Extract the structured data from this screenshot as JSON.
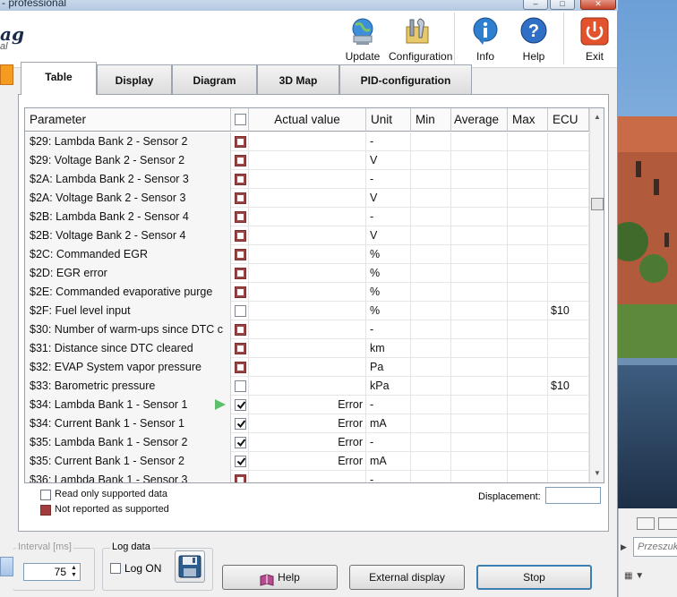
{
  "window": {
    "title": "- professional",
    "brand": "ag",
    "brand_sub": "al"
  },
  "toolbar": [
    {
      "label": "Update",
      "icon": "update-globe-icon"
    },
    {
      "label": "Configuration",
      "icon": "configuration-tools-icon"
    },
    {
      "label": "Info",
      "icon": "info-icon"
    },
    {
      "label": "Help",
      "icon": "help-question-icon"
    },
    {
      "label": "Exit",
      "icon": "power-exit-icon"
    }
  ],
  "tabs": [
    "Table",
    "Display",
    "Diagram",
    "3D Map",
    "PID-configuration"
  ],
  "active_tab": "Table",
  "columns": {
    "parameter": "Parameter",
    "actual": "Actual value",
    "unit": "Unit",
    "min": "Min",
    "average": "Average",
    "max": "Max",
    "ecu": "ECU"
  },
  "rows": [
    {
      "name": "$29: Lambda Bank 2 - Sensor 2",
      "state": "ns",
      "actual": "",
      "unit": "-",
      "ecu": ""
    },
    {
      "name": "$29: Voltage Bank 2 - Sensor 2",
      "state": "ns",
      "actual": "",
      "unit": "V",
      "ecu": ""
    },
    {
      "name": "$2A: Lambda Bank 2 - Sensor 3",
      "state": "ns",
      "actual": "",
      "unit": "-",
      "ecu": ""
    },
    {
      "name": "$2A: Voltage Bank 2 - Sensor 3",
      "state": "ns",
      "actual": "",
      "unit": "V",
      "ecu": ""
    },
    {
      "name": "$2B: Lambda Bank 2 - Sensor 4",
      "state": "ns",
      "actual": "",
      "unit": "-",
      "ecu": ""
    },
    {
      "name": "$2B: Voltage Bank 2 - Sensor 4",
      "state": "ns",
      "actual": "",
      "unit": "V",
      "ecu": ""
    },
    {
      "name": "$2C: Commanded EGR",
      "state": "ns",
      "actual": "",
      "unit": "%",
      "ecu": ""
    },
    {
      "name": "$2D: EGR error",
      "state": "ns",
      "actual": "",
      "unit": "%",
      "ecu": ""
    },
    {
      "name": "$2E: Commanded evaporative purge",
      "state": "ns",
      "actual": "",
      "unit": "%",
      "ecu": ""
    },
    {
      "name": "$2F: Fuel level input",
      "state": "off",
      "actual": "",
      "unit": "%",
      "ecu": "$10"
    },
    {
      "name": "$30: Number of warm-ups since DTC c",
      "state": "ns",
      "actual": "",
      "unit": "-",
      "ecu": ""
    },
    {
      "name": "$31: Distance since DTC cleared",
      "state": "ns",
      "actual": "",
      "unit": "km",
      "ecu": ""
    },
    {
      "name": "$32: EVAP System vapor pressure",
      "state": "ns",
      "actual": "",
      "unit": "Pa",
      "ecu": ""
    },
    {
      "name": "$33: Barometric pressure",
      "state": "off",
      "actual": "",
      "unit": "kPa",
      "ecu": "$10"
    },
    {
      "name": "$34: Lambda Bank 1 - Sensor 1",
      "state": "on",
      "actual": "Error",
      "unit": "-",
      "ecu": "",
      "marker": true
    },
    {
      "name": "$34: Current Bank 1 - Sensor 1",
      "state": "on",
      "actual": "Error",
      "unit": "mA",
      "ecu": ""
    },
    {
      "name": "$35: Lambda Bank 1 - Sensor 2",
      "state": "on",
      "actual": "Error",
      "unit": "-",
      "ecu": ""
    },
    {
      "name": "$35: Current Bank 1 - Sensor 2",
      "state": "on",
      "actual": "Error",
      "unit": "mA",
      "ecu": ""
    },
    {
      "name": "$36: Lambda Bank 1 - Sensor 3",
      "state": "ns",
      "actual": "",
      "unit": "-",
      "ecu": ""
    }
  ],
  "legend": {
    "read_only": "Read only supported data",
    "not_reported": "Not reported as supported",
    "displacement_label": "Displacement:",
    "displacement_value": ""
  },
  "interval": {
    "label": "Interval [ms]",
    "value": "75"
  },
  "log": {
    "group_label": "Log data",
    "checkbox_label": "Log ON",
    "checked": false
  },
  "buttons": {
    "help": "Help",
    "external": "External display",
    "stop": "Stop"
  },
  "taskbar": {
    "search_text": "Przeszuk"
  },
  "colors": {
    "not_supported": "#a33c3c",
    "accent": "#3c7fb1",
    "marker": "#5dbf6a"
  }
}
